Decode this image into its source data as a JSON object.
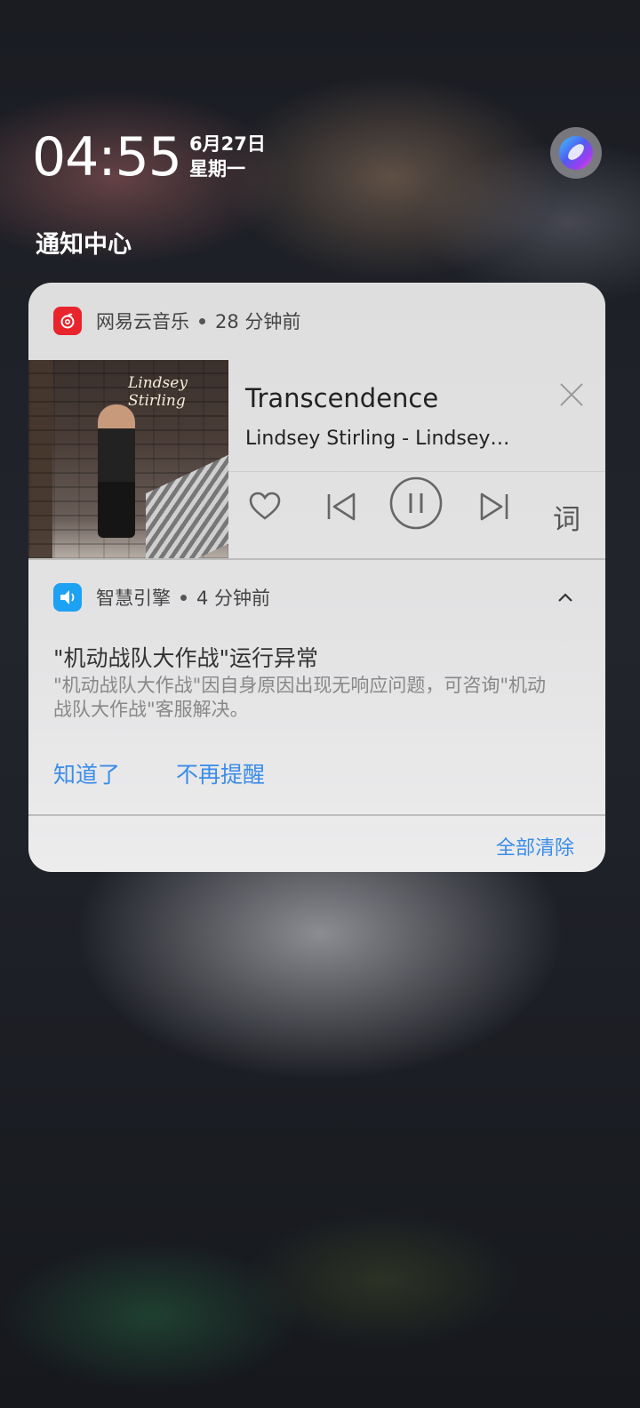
{
  "status": {
    "time": "04:55",
    "date": "6月27日",
    "weekday": "星期一"
  },
  "header": {
    "title": "通知中心"
  },
  "music_notification": {
    "app_name": "网易云音乐",
    "time_ago": "28 分钟前",
    "album_caption": "Lindsey Stirling",
    "track_title": "Transcendence",
    "track_artist": "Lindsey Stirling - Lindsey…",
    "lyrics_label": "词",
    "icons": [
      "heart-icon",
      "previous-icon",
      "pause-icon",
      "next-icon",
      "close-icon"
    ],
    "accent_color": "#e8242d"
  },
  "system_notification": {
    "app_name": "智慧引擎",
    "time_ago": "4 分钟前",
    "title": "\"机动战队大作战\"运行异常",
    "body": "\"机动战队大作战\"因自身原因出现无响应问题，可咨询\"机动战队大作战\"客服解决。",
    "action_ack": "知道了",
    "action_mute": "不再提醒",
    "accent_color": "#1da1f2"
  },
  "footer": {
    "clear_all": "全部清除"
  },
  "colors": {
    "link_blue": "#3b8de8"
  }
}
